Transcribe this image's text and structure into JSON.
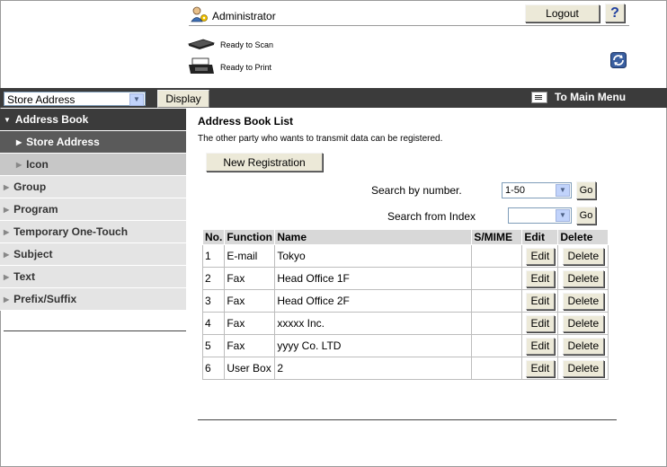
{
  "header": {
    "user": "Administrator",
    "logout_label": "Logout",
    "help_label": "?",
    "status_scan": "Ready to Scan",
    "status_print": "Ready to Print"
  },
  "bar": {
    "select_value": "Store Address",
    "display_label": "Display",
    "main_menu_label": "To Main Menu"
  },
  "sidebar": {
    "items": [
      {
        "label": "Address Book"
      },
      {
        "label": "Store Address"
      },
      {
        "label": "Icon"
      },
      {
        "label": "Group"
      },
      {
        "label": "Program"
      },
      {
        "label": "Temporary One-Touch"
      },
      {
        "label": "Subject"
      },
      {
        "label": "Text"
      },
      {
        "label": "Prefix/Suffix"
      }
    ]
  },
  "main": {
    "title": "Address Book List",
    "description": "The other party who wants to transmit data can be registered.",
    "new_registration_label": "New Registration",
    "search_number_label": "Search by number.",
    "search_number_value": "1-50",
    "search_index_label": "Search from Index",
    "search_index_value": "",
    "go_label": "Go"
  },
  "table": {
    "headers": [
      "No.",
      "Function",
      "Name",
      "S/MIME",
      "Edit",
      "Delete"
    ],
    "edit_label": "Edit",
    "delete_label": "Delete",
    "rows": [
      {
        "no": "1",
        "function": "E-mail",
        "name": "Tokyo",
        "smime": ""
      },
      {
        "no": "2",
        "function": "Fax",
        "name": "Head Office 1F",
        "smime": ""
      },
      {
        "no": "3",
        "function": "Fax",
        "name": "Head Office 2F",
        "smime": ""
      },
      {
        "no": "4",
        "function": "Fax",
        "name": "xxxxx Inc.",
        "smime": ""
      },
      {
        "no": "5",
        "function": "Fax",
        "name": "yyyy Co. LTD",
        "smime": ""
      },
      {
        "no": "6",
        "function": "User Box",
        "name": "2",
        "smime": ""
      }
    ]
  }
}
